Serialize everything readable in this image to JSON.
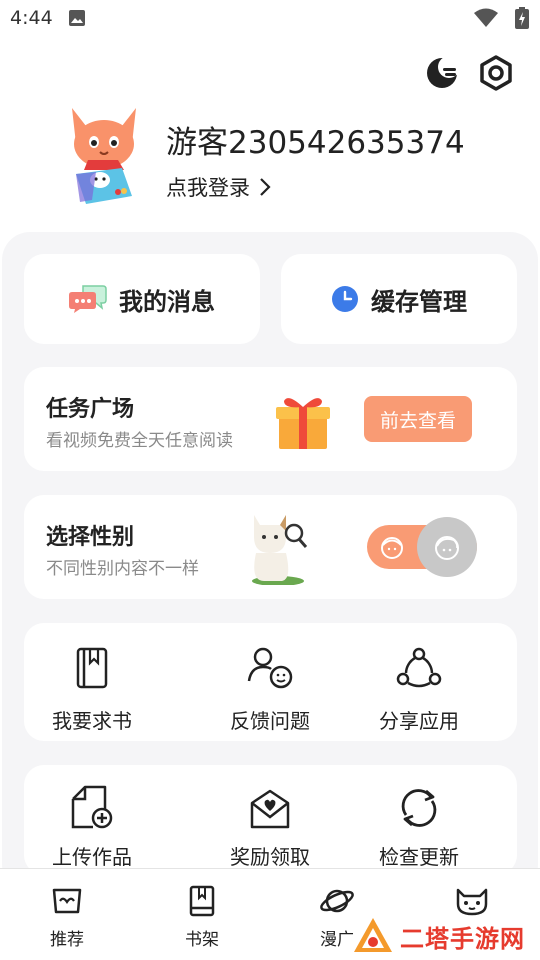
{
  "status_bar": {
    "time": "4:44"
  },
  "profile": {
    "username": "游客230542635374",
    "login_label": "点我登录"
  },
  "quick_actions": {
    "messages": "我的消息",
    "cache": "缓存管理"
  },
  "task_card": {
    "title": "任务广场",
    "subtitle": "看视频免费全天任意阅读",
    "button": "前去查看"
  },
  "gender_card": {
    "title": "选择性别",
    "subtitle": "不同性别内容不一样"
  },
  "tools_row1": [
    {
      "label": "我要求书",
      "icon": "book-request-icon"
    },
    {
      "label": "反馈问题",
      "icon": "feedback-user-icon"
    },
    {
      "label": "分享应用",
      "icon": "share-icon"
    }
  ],
  "tools_row2": [
    {
      "label": "上传作品",
      "icon": "upload-file-icon"
    },
    {
      "label": "奖励领取",
      "icon": "reward-envelope-icon"
    },
    {
      "label": "检查更新",
      "icon": "refresh-icon"
    }
  ],
  "bottom_nav": [
    {
      "label": "推荐",
      "icon": "recommend-icon"
    },
    {
      "label": "书架",
      "icon": "bookshelf-icon"
    },
    {
      "label": "漫广",
      "icon": "planet-icon"
    },
    {
      "label": "",
      "icon": "cat-face-icon"
    }
  ],
  "watermark": {
    "text": "二塔手游网"
  },
  "colors": {
    "accent": "#f99b74",
    "panel_bg": "#f5f5f7",
    "watermark": "#e63b2e"
  }
}
